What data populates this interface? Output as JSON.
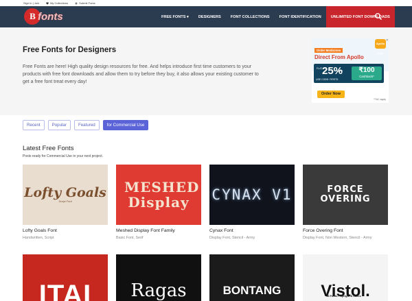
{
  "topbar": {
    "signin": "Sign In | Join",
    "collections": "My Collections",
    "submit": "Submit Fonts"
  },
  "brand": {
    "logo_letters": "B",
    "logo_text": "fonts"
  },
  "nav": {
    "items": [
      {
        "label": "FREE FONTS"
      },
      {
        "label": "DESIGNERS"
      },
      {
        "label": "FONT COLLECTIONS"
      },
      {
        "label": "FONT IDENTIFICATION"
      },
      {
        "label": "UNLIMITED FONT DOWNLOADS"
      }
    ],
    "free_fonts_caret": "▾"
  },
  "hero": {
    "title": "Free Fonts for Designers",
    "description": "Free Fonts are here! High quality design resources for free. And helps introduce first time customers to your products with free font downloads and allow them to try before they buy, it also allows your existing customer to get a free font treat every day!"
  },
  "ad": {
    "brand": "Apollo 24|7",
    "close": "✕",
    "order_tag": "Order Medicines",
    "headline": "Direct From Apollo",
    "flat": "FLAT",
    "percent": "25%",
    "off": "OFF",
    "cashback_amount": "₹100",
    "cashback_label": "Cashback*",
    "code": "USE CODE: FIRST5",
    "button": "Order Now",
    "tc": "*T&C apply"
  },
  "tabs": [
    {
      "label": "Recent",
      "active": false
    },
    {
      "label": "Popular",
      "active": false
    },
    {
      "label": "Featured",
      "active": false
    },
    {
      "label": "for Commercial Use",
      "active": true
    }
  ],
  "section": {
    "title": "Latest Free Fonts",
    "subtitle": "Posts ready for Commercial Use in your next project."
  },
  "cards": [
    {
      "name": "Lofty Goals Font",
      "categories": "Handwritten, Script",
      "art": "Lofty Goals",
      "art_sub": "Script Font"
    },
    {
      "name": "Meshed Display Font Family",
      "categories": "Basic Font, Serif",
      "art": "MESHED Display"
    },
    {
      "name": "Cynax Font",
      "categories": "Display Font, Stencil - Army",
      "art": "CYNAX V1"
    },
    {
      "name": "Force Overing Font",
      "categories": "Display Font, Non Western, Stencil - Army",
      "art": "FORCE OVERING"
    },
    {
      "name": "",
      "categories": "",
      "art": "ITAI"
    },
    {
      "name": "",
      "categories": "",
      "art": "Ragas"
    },
    {
      "name": "",
      "categories": "",
      "art": "BONTANG"
    },
    {
      "name": "",
      "categories": "",
      "art": "Vistol.",
      "art_sub": "18 Fonts • Upright & Italics"
    }
  ],
  "colors": {
    "nav_bg": "#2b3c51",
    "nav_highlight": "#c9252c",
    "accent": "#5a63d8",
    "hero_bg": "#f5f5f5"
  }
}
